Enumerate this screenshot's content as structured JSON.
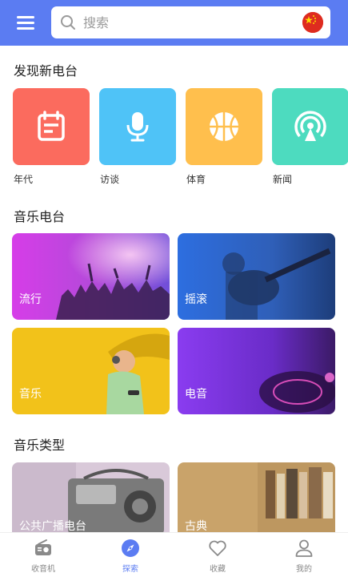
{
  "search": {
    "placeholder": "搜索",
    "region_icon": "china-flag-icon"
  },
  "discover": {
    "title": "发现新电台",
    "categories": [
      {
        "label": "年代",
        "icon": "calendar-icon",
        "color": "#fb6b5e"
      },
      {
        "label": "访谈",
        "icon": "microphone-icon",
        "color": "#4fc3f7"
      },
      {
        "label": "体育",
        "icon": "basketball-icon",
        "color": "#ffbf4d"
      },
      {
        "label": "新闻",
        "icon": "broadcast-icon",
        "color": "#4ddbbf"
      }
    ]
  },
  "music_stations": {
    "title": "音乐电台",
    "cards": [
      {
        "label": "流行"
      },
      {
        "label": "摇滚"
      },
      {
        "label": "音乐"
      },
      {
        "label": "电音"
      }
    ]
  },
  "music_types": {
    "title": "音乐类型",
    "cards": [
      {
        "label": "公共广播电台"
      },
      {
        "label": "古典"
      }
    ]
  },
  "bottom_nav": {
    "items": [
      {
        "label": "收音机",
        "icon": "radio-icon",
        "active": false
      },
      {
        "label": "探索",
        "icon": "compass-icon",
        "active": true
      },
      {
        "label": "收藏",
        "icon": "heart-icon",
        "active": false
      },
      {
        "label": "我的",
        "icon": "user-icon",
        "active": false
      }
    ]
  },
  "colors": {
    "accent": "#5b7cf2",
    "nav_inactive": "#888888"
  }
}
